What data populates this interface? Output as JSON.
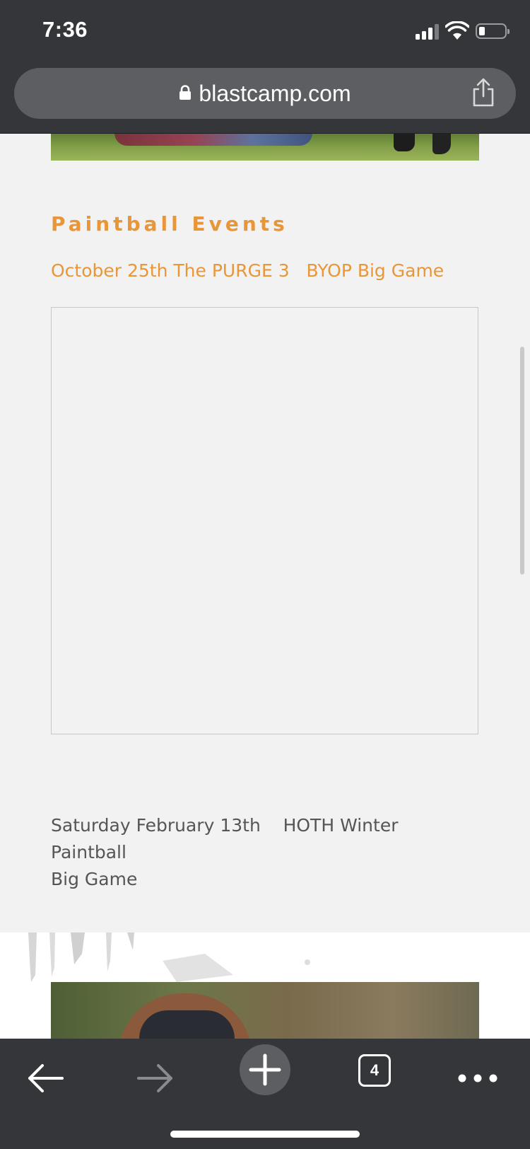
{
  "status_bar": {
    "time": "7:36",
    "icons": [
      "signal-icon",
      "wifi-icon",
      "battery-icon"
    ]
  },
  "browser": {
    "url": "blastcamp.com",
    "tab_count": "4",
    "icons": [
      "lock-icon",
      "share-icon",
      "back-icon",
      "forward-icon",
      "new-tab-icon",
      "more-icon"
    ]
  },
  "content": {
    "section_title": "Paintball Events",
    "event_link": "October 25th The PURGE 3   BYOP Big Game",
    "event_text": "Saturday February 13th    HOTH Winter Paintball\nBig Game"
  },
  "colors": {
    "accent": "#e89638",
    "chrome": "#35363a",
    "page_bg": "#f2f2f2"
  }
}
